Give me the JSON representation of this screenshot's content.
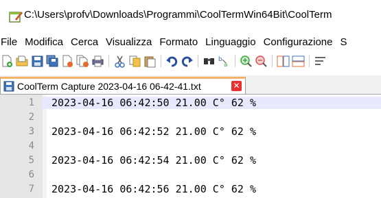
{
  "window": {
    "title": "C:\\Users\\profv\\Downloads\\Programmi\\CoolTermWin64Bit\\CoolTerm"
  },
  "menu": {
    "items": [
      "File",
      "Modifica",
      "Cerca",
      "Visualizza",
      "Formato",
      "Linguaggio",
      "Configurazione",
      "S"
    ]
  },
  "toolbar": {
    "icons": [
      "new-file-icon",
      "open-file-icon",
      "save-icon",
      "save-all-icon",
      "close-icon",
      "close-all-icon",
      "print-icon",
      "cut-icon",
      "copy-icon",
      "paste-icon",
      "undo-icon",
      "redo-icon",
      "find-icon",
      "replace-icon",
      "zoom-in-icon",
      "zoom-out-icon",
      "sync-vertical-icon",
      "sync-horizontal-icon",
      "word-wrap-icon"
    ]
  },
  "tab": {
    "label": "CoolTerm Capture 2023-04-16 06-42-41.txt",
    "close_glyph": "✕"
  },
  "editor": {
    "lines": [
      {
        "num": "1",
        "text": "2023-04-16 06:42:50 21.00 C° 62 %"
      },
      {
        "num": "2",
        "text": ""
      },
      {
        "num": "3",
        "text": "2023-04-16 06:42:52 21.00 C° 62 %"
      },
      {
        "num": "4",
        "text": ""
      },
      {
        "num": "5",
        "text": "2023-04-16 06:42:54 21.00 C° 62 %"
      },
      {
        "num": "6",
        "text": ""
      },
      {
        "num": "7",
        "text": "2023-04-16 06:42:56 21.00 C° 62 %"
      }
    ]
  },
  "colors": {
    "tab_accent": "#f7b267",
    "active_line": "#e8e8ff",
    "gutter": "#e6e6e6",
    "close_button": "#e8302f"
  }
}
